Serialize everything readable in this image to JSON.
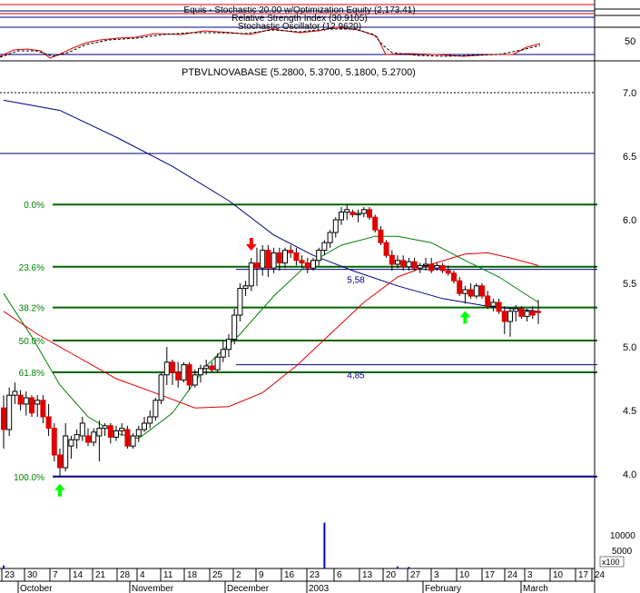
{
  "header": {
    "equity_label": "Equis - Stochastic 20.00 w/Optimization Equity (2,173.41)",
    "rsi_label": "Relative Strength Index (30.9105)",
    "stoch_label": "Stochastic Oscillator (12.9620)",
    "indicator_tick": "50"
  },
  "chart_data": {
    "type": "candlestick",
    "title": "PTBVLNOVABASE (5.2800, 5.3700, 5.1800, 5.2700)",
    "ylim": [
      3.75,
      7.2
    ],
    "y_ticks": [
      4.0,
      4.5,
      5.0,
      5.5,
      6.0,
      6.5,
      7.0
    ],
    "y_tick_labels": [
      "4.0",
      "4.5",
      "5.0",
      "5.5",
      "6.0",
      "6.5",
      "7.0"
    ],
    "x_tick_labels": [
      "23",
      "30",
      "7",
      "14",
      "21",
      "28",
      "4",
      "11",
      "18",
      "25",
      "2",
      "9",
      "16",
      "23",
      "6",
      "13",
      "20",
      "27",
      "3",
      "10",
      "17",
      "24",
      "3",
      "10",
      "17",
      "24"
    ],
    "month_labels": [
      "October",
      "November",
      "December",
      "2003",
      "February",
      "March"
    ],
    "fibonacci": [
      {
        "label": "0.0%",
        "value": 6.12
      },
      {
        "label": "23.6%",
        "value": 5.63
      },
      {
        "label": "38.2%",
        "value": 5.31
      },
      {
        "label": "50.0%",
        "value": 5.05
      },
      {
        "label": "61.8%",
        "value": 4.8
      },
      {
        "label": "100.0%",
        "value": 3.98
      }
    ],
    "horizontal_levels": [
      {
        "label": "5,58",
        "value": 5.61
      },
      {
        "label": "4,85",
        "value": 4.86
      }
    ],
    "candles": [
      [
        4.52,
        4.62,
        4.2,
        4.35
      ],
      [
        4.35,
        4.68,
        4.3,
        4.62
      ],
      [
        4.62,
        4.72,
        4.55,
        4.65
      ],
      [
        4.62,
        4.66,
        4.5,
        4.55
      ],
      [
        4.55,
        4.65,
        4.46,
        4.6
      ],
      [
        4.6,
        4.62,
        4.45,
        4.48
      ],
      [
        4.55,
        4.62,
        4.45,
        4.58
      ],
      [
        4.58,
        4.62,
        4.4,
        4.45
      ],
      [
        4.45,
        4.55,
        4.3,
        4.36
      ],
      [
        4.36,
        4.4,
        4.1,
        4.15
      ],
      [
        4.15,
        4.2,
        3.98,
        4.05
      ],
      [
        4.05,
        4.4,
        4.02,
        4.3
      ],
      [
        4.22,
        4.3,
        4.12,
        4.27
      ],
      [
        4.27,
        4.35,
        4.2,
        4.31
      ],
      [
        4.3,
        4.45,
        4.26,
        4.4
      ],
      [
        4.3,
        4.36,
        4.22,
        4.25
      ],
      [
        4.25,
        4.36,
        4.22,
        4.33
      ],
      [
        4.3,
        4.42,
        4.1,
        4.36
      ],
      [
        4.36,
        4.4,
        4.3,
        4.38
      ],
      [
        4.38,
        4.4,
        4.24,
        4.29
      ],
      [
        4.29,
        4.38,
        4.26,
        4.34
      ],
      [
        4.34,
        4.4,
        4.3,
        4.36
      ],
      [
        4.35,
        4.38,
        4.2,
        4.22
      ],
      [
        4.22,
        4.32,
        4.2,
        4.3
      ],
      [
        4.3,
        4.38,
        4.25,
        4.35
      ],
      [
        4.35,
        4.45,
        4.33,
        4.4
      ],
      [
        4.4,
        4.5,
        4.36,
        4.45
      ],
      [
        4.45,
        4.6,
        4.42,
        4.58
      ],
      [
        4.58,
        4.8,
        4.55,
        4.78
      ],
      [
        4.78,
        5.0,
        4.7,
        4.88
      ],
      [
        4.88,
        4.9,
        4.7,
        4.8
      ],
      [
        4.8,
        4.88,
        4.68,
        4.74
      ],
      [
        4.74,
        4.88,
        4.72,
        4.86
      ],
      [
        4.86,
        4.88,
        4.66,
        4.7
      ],
      [
        4.7,
        4.82,
        4.68,
        4.78
      ],
      [
        4.78,
        4.86,
        4.72,
        4.83
      ],
      [
        4.83,
        4.9,
        4.78,
        4.85
      ],
      [
        4.85,
        4.88,
        4.8,
        4.82
      ],
      [
        4.82,
        4.95,
        4.8,
        4.92
      ],
      [
        4.92,
        5.05,
        4.88,
        4.98
      ],
      [
        4.98,
        5.1,
        4.92,
        5.06
      ],
      [
        5.06,
        5.3,
        5.02,
        5.25
      ],
      [
        5.25,
        5.5,
        5.2,
        5.46
      ],
      [
        5.46,
        5.52,
        5.4,
        5.48
      ],
      [
        5.48,
        5.7,
        5.44,
        5.66
      ],
      [
        5.66,
        5.78,
        5.48,
        5.62
      ],
      [
        5.62,
        5.8,
        5.56,
        5.76
      ],
      [
        5.76,
        5.8,
        5.55,
        5.62
      ],
      [
        5.62,
        5.78,
        5.58,
        5.74
      ],
      [
        5.74,
        5.78,
        5.6,
        5.66
      ],
      [
        5.66,
        5.78,
        5.62,
        5.76
      ],
      [
        5.76,
        5.8,
        5.7,
        5.74
      ],
      [
        5.74,
        5.78,
        5.64,
        5.68
      ],
      [
        5.68,
        5.72,
        5.62,
        5.66
      ],
      [
        5.66,
        5.7,
        5.58,
        5.62
      ],
      [
        5.62,
        5.7,
        5.6,
        5.68
      ],
      [
        5.68,
        5.78,
        5.64,
        5.76
      ],
      [
        5.76,
        5.84,
        5.72,
        5.82
      ],
      [
        5.82,
        5.92,
        5.78,
        5.9
      ],
      [
        5.9,
        6.02,
        5.86,
        6.0
      ],
      [
        6.0,
        6.1,
        5.96,
        6.06
      ],
      [
        6.06,
        6.12,
        6.0,
        6.08
      ],
      [
        6.06,
        6.08,
        6.02,
        6.04
      ],
      [
        6.04,
        6.08,
        5.98,
        6.05
      ],
      [
        6.05,
        6.1,
        6.02,
        6.08
      ],
      [
        6.08,
        6.1,
        6.0,
        6.02
      ],
      [
        6.02,
        6.04,
        5.9,
        5.92
      ],
      [
        5.92,
        5.95,
        5.8,
        5.82
      ],
      [
        5.82,
        5.84,
        5.7,
        5.72
      ],
      [
        5.72,
        5.76,
        5.6,
        5.65
      ],
      [
        5.65,
        5.72,
        5.62,
        5.68
      ],
      [
        5.68,
        5.72,
        5.6,
        5.63
      ],
      [
        5.63,
        5.7,
        5.6,
        5.67
      ],
      [
        5.67,
        5.7,
        5.6,
        5.62
      ],
      [
        5.62,
        5.66,
        5.58,
        5.64
      ],
      [
        5.64,
        5.7,
        5.6,
        5.65
      ],
      [
        5.65,
        5.7,
        5.58,
        5.6
      ],
      [
        5.62,
        5.66,
        5.6,
        5.64
      ],
      [
        5.64,
        5.66,
        5.58,
        5.6
      ],
      [
        5.6,
        5.64,
        5.56,
        5.58
      ],
      [
        5.58,
        5.6,
        5.5,
        5.52
      ],
      [
        5.52,
        5.55,
        5.4,
        5.42
      ],
      [
        5.42,
        5.48,
        5.34,
        5.45
      ],
      [
        5.45,
        5.5,
        5.38,
        5.4
      ],
      [
        5.4,
        5.5,
        5.38,
        5.48
      ],
      [
        5.48,
        5.5,
        5.38,
        5.4
      ],
      [
        5.4,
        5.44,
        5.3,
        5.32
      ],
      [
        5.32,
        5.38,
        5.28,
        5.35
      ],
      [
        5.35,
        5.38,
        5.26,
        5.28
      ],
      [
        5.28,
        5.32,
        5.1,
        5.2
      ],
      [
        5.2,
        5.3,
        5.08,
        5.28
      ],
      [
        5.28,
        5.33,
        5.2,
        5.3
      ],
      [
        5.3,
        5.32,
        5.22,
        5.24
      ],
      [
        5.24,
        5.3,
        5.2,
        5.28
      ],
      [
        5.28,
        5.32,
        5.22,
        5.25
      ],
      [
        5.28,
        5.37,
        5.18,
        5.27
      ]
    ],
    "moving_averages": [
      {
        "color": "#000080",
        "points": [
          [
            0,
            6.94
          ],
          [
            10,
            6.86
          ],
          [
            20,
            6.65
          ],
          [
            30,
            6.42
          ],
          [
            40,
            6.15
          ],
          [
            48,
            5.88
          ],
          [
            55,
            5.72
          ],
          [
            62,
            5.6
          ],
          [
            70,
            5.48
          ],
          [
            78,
            5.38
          ],
          [
            86,
            5.32
          ],
          [
            95,
            5.28
          ]
        ]
      },
      {
        "color": "#008000",
        "points": [
          [
            0,
            5.42
          ],
          [
            5,
            5.08
          ],
          [
            10,
            4.7
          ],
          [
            15,
            4.45
          ],
          [
            20,
            4.32
          ],
          [
            24,
            4.28
          ],
          [
            30,
            4.48
          ],
          [
            36,
            4.85
          ],
          [
            42,
            5.1
          ],
          [
            48,
            5.4
          ],
          [
            54,
            5.65
          ],
          [
            60,
            5.8
          ],
          [
            66,
            5.87
          ],
          [
            70,
            5.87
          ],
          [
            76,
            5.82
          ],
          [
            82,
            5.68
          ],
          [
            88,
            5.55
          ],
          [
            95,
            5.35
          ]
        ]
      },
      {
        "color": "#e00000",
        "points": [
          [
            0,
            5.28
          ],
          [
            6,
            5.1
          ],
          [
            12,
            4.95
          ],
          [
            20,
            4.75
          ],
          [
            28,
            4.62
          ],
          [
            34,
            4.52
          ],
          [
            40,
            4.53
          ],
          [
            46,
            4.64
          ],
          [
            52,
            4.85
          ],
          [
            58,
            5.1
          ],
          [
            64,
            5.35
          ],
          [
            70,
            5.55
          ],
          [
            76,
            5.65
          ],
          [
            82,
            5.73
          ],
          [
            86,
            5.74
          ],
          [
            90,
            5.7
          ],
          [
            95,
            5.64
          ]
        ]
      }
    ],
    "volume": {
      "scale_labels": [
        "10000",
        "5000"
      ],
      "unit_label": "x100",
      "spikes": [
        [
          0,
          600
        ],
        [
          57,
          9000
        ],
        [
          70,
          400
        ],
        [
          72,
          300
        ]
      ]
    },
    "markers": [
      {
        "type": "up",
        "index": 10
      },
      {
        "type": "down",
        "index": 44
      },
      {
        "type": "up",
        "index": 82
      }
    ]
  }
}
